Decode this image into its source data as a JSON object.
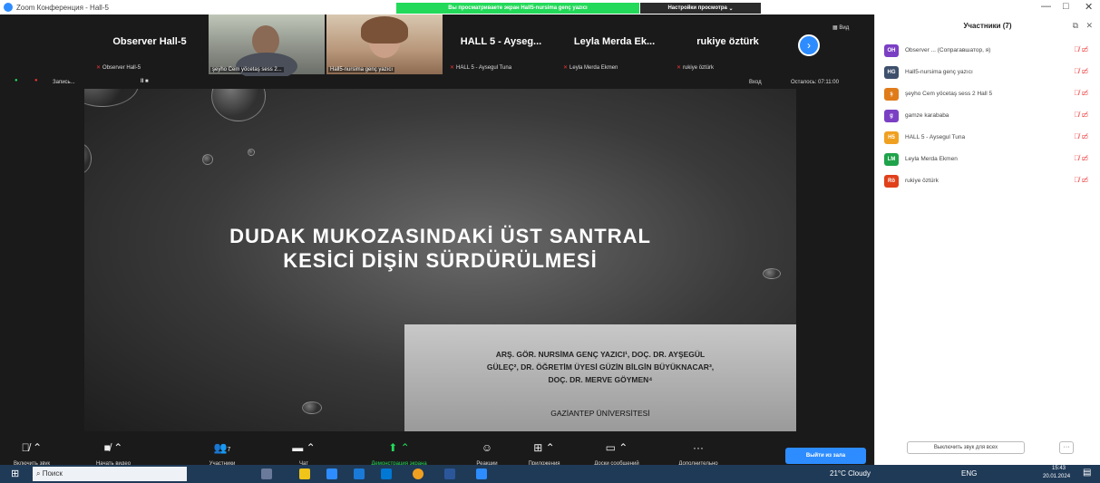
{
  "window": {
    "title": "Zoom Конференция - Hall-5",
    "share_banner": "Вы просматриваете экран Hall5-nursima genç yazıcı",
    "view_options": "Настройки просмотра"
  },
  "participant_strip": {
    "tiles": [
      {
        "name": "Observer Hall-5",
        "sub": "Observer Hall-5"
      },
      {
        "name": "",
        "sub": "şeyho Cem yöcetaş sess 2..."
      },
      {
        "name": "",
        "sub": "Hall5-nursima genç yazıcı"
      },
      {
        "name": "HALL 5 - Ayseg...",
        "sub": "HALL 5 - Aysegul Tuna"
      },
      {
        "name": "Leyla Merda Ek...",
        "sub": "Leyla Merda Ekmen"
      },
      {
        "name": "rukiye öztürk",
        "sub": "rukiye öztürk"
      }
    ],
    "view_label": "Вид"
  },
  "recording": {
    "label": "Запись...",
    "enter_label": "Вход",
    "timer": "Осталось: 07:11:00"
  },
  "slide": {
    "title_line1": "DUDAK MUKOZASINDAKİ ÜST SANTRAL",
    "title_line2": "KESİCİ DİŞİN SÜRDÜRÜLMESİ",
    "authors_line1": "ARŞ. GÖR. NURSİMA GENÇ YAZICI¹, DOÇ. DR. AYŞEGÜL",
    "authors_line2": "GÜLEÇ², DR. ÖĞRETİM ÜYESİ GÜZİN BİLGİN BÜYÜKNACAR³,",
    "authors_line3": "DOÇ. DR. MERVE GÖYMEN⁴",
    "university": "GAZİANTEP ÜNİVERSİTESİ"
  },
  "toolbar": {
    "unmute": "Включить звук",
    "video": "Начать видео",
    "participants": "Участники",
    "participants_count": "7",
    "chat": "Чат",
    "share": "Демонстрация экрана",
    "reactions": "Реакции",
    "apps": "Приложения",
    "whiteboards": "Доски сообщений",
    "more": "Дополнительно",
    "leave": "Выйти из зала"
  },
  "panel": {
    "title": "Участники (7)",
    "participants": [
      {
        "initials": "OH",
        "name": "Observer ... (Сопрагавшатор, я)",
        "color": "#7b3fc4"
      },
      {
        "initials": "HG",
        "name": "Hall5-nursima genç yazıcı",
        "color": "#3d4f6b"
      },
      {
        "initials": "ş",
        "name": "şeyho Cem yöcetaş sess 2 Hall 5",
        "color": "#e07b1a"
      },
      {
        "initials": "g",
        "name": "gamze karababa",
        "color": "#7b3fc4"
      },
      {
        "initials": "H5",
        "name": "HALL 5 - Aysegul Tuna",
        "color": "#f0a020"
      },
      {
        "initials": "LM",
        "name": "Leyla Merda Ekmen",
        "color": "#1fa34a"
      },
      {
        "initials": "Rö",
        "name": "rukiye öztürk",
        "color": "#e0401a"
      }
    ],
    "mute_all": "Выключить звук для всех",
    "more": "···"
  },
  "taskbar": {
    "search": "Поиск",
    "weather": "21°C Cloudy",
    "lang": "ENG",
    "time": "15:43",
    "date": "20.01.2024"
  }
}
